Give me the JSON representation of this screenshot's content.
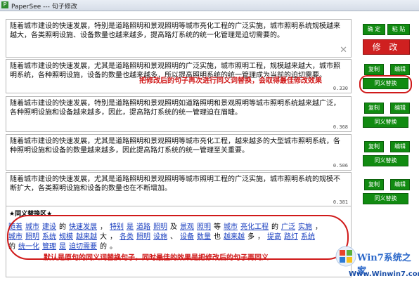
{
  "window": {
    "title": "PaperSee --- 句子修改",
    "icon": "P"
  },
  "source": {
    "text": "随着城市建设的快速发展，特别是道路照明和景观照明等城市亮化工程的广泛实施，城市照明系统规模越来越大，各类照明设施、设备数量也越来越多，提高路灯系统的统一化管理是迫切需要的。",
    "confirm_label": "确 定",
    "paste_label": "粘 贴",
    "modify_label": "修 改"
  },
  "results": [
    {
      "text": "随着城市建设的快速发展，尤其是道路照明和景观照明的广泛实施，城市照明工程，规模越来越大，城市照明系统，各种照明设施，设备的数量也越来越多，所以提高照明系统的统一管理成为当前的迫切需要。",
      "score": "0.330"
    },
    {
      "text": "随着城市建设的快速发展，特别是道路照明和景观照明如道路照明和景观照明等城市照明系统越来越广泛，各种照明设施和设备越来越多，因此，提高路灯系统的统一管理迫在眉睫。",
      "score": "0.368"
    },
    {
      "text": "随着城市建设的快速发展，尤其是道路照明和景观照明等城市亮化工程，越来越多的大型城市照明系统，各种照明设施和设备的数量越来越多，因此提高路灯系统的统一管理至关重要。",
      "score": "0.506"
    },
    {
      "text": "随着城市建设的快速发展，尤其是道路照明和景观照明等城市照明工程的广泛实施，城市照明系统的规模不断扩大，各类照明设施和设备的数量也在不断增加。",
      "score": "0.381"
    }
  ],
  "result_buttons": {
    "copy": "复制",
    "edit": "编辑",
    "replace": "同义替换"
  },
  "annotations": {
    "top": "把修改后的句子再次进行同义词替换，会取得最佳修改效果",
    "bottom": "默认是原句的同义词替换句子，同时最佳的效果是把修改后的句子再同义"
  },
  "synonym_area": {
    "header": "★同义替换区★",
    "line1": [
      {
        "t": "随着",
        "l": true
      },
      {
        "t": "城市",
        "l": true
      },
      {
        "t": "建设",
        "l": true
      },
      {
        "t": "的",
        "l": false
      },
      {
        "t": "快速发展",
        "l": true
      },
      {
        "t": "，",
        "l": false
      },
      {
        "t": "特别",
        "l": true
      },
      {
        "t": "是",
        "l": true
      },
      {
        "t": "道路",
        "l": true
      },
      {
        "t": "照明",
        "l": true
      },
      {
        "t": "及",
        "l": false
      },
      {
        "t": "景观",
        "l": true
      },
      {
        "t": "照明",
        "l": true
      },
      {
        "t": "等",
        "l": false
      },
      {
        "t": "城市",
        "l": true
      },
      {
        "t": "亮化工程",
        "l": true
      },
      {
        "t": "的",
        "l": false
      },
      {
        "t": "广泛",
        "l": true
      },
      {
        "t": "实施",
        "l": true
      },
      {
        "t": "，",
        "l": false
      }
    ],
    "line2": [
      {
        "t": "城市",
        "l": true
      },
      {
        "t": "照明",
        "l": true
      },
      {
        "t": "系统",
        "l": true
      },
      {
        "t": "规模",
        "l": true
      },
      {
        "t": "越来越",
        "l": true
      },
      {
        "t": "大",
        "l": false
      },
      {
        "t": "，",
        "l": false
      },
      {
        "t": "各类",
        "l": true
      },
      {
        "t": "照明",
        "l": true
      },
      {
        "t": "设施",
        "l": true
      },
      {
        "t": "、",
        "l": false
      },
      {
        "t": "设备",
        "l": true
      },
      {
        "t": "数量",
        "l": true
      },
      {
        "t": "也",
        "l": false
      },
      {
        "t": "越来越",
        "l": true
      },
      {
        "t": "多",
        "l": false
      },
      {
        "t": "，",
        "l": false
      },
      {
        "t": "提高",
        "l": true
      },
      {
        "t": "路灯",
        "l": true
      },
      {
        "t": "系统",
        "l": true
      }
    ],
    "line3": [
      {
        "t": "的",
        "l": false
      },
      {
        "t": "统一化",
        "l": true
      },
      {
        "t": "管理",
        "l": true
      },
      {
        "t": "是",
        "l": true
      },
      {
        "t": "迫切需要",
        "l": true
      },
      {
        "t": "的",
        "l": false
      },
      {
        "t": "。",
        "l": false
      }
    ]
  },
  "watermark": {
    "brand": "Win7系统之家",
    "url": "Www.Winwin7.com"
  }
}
